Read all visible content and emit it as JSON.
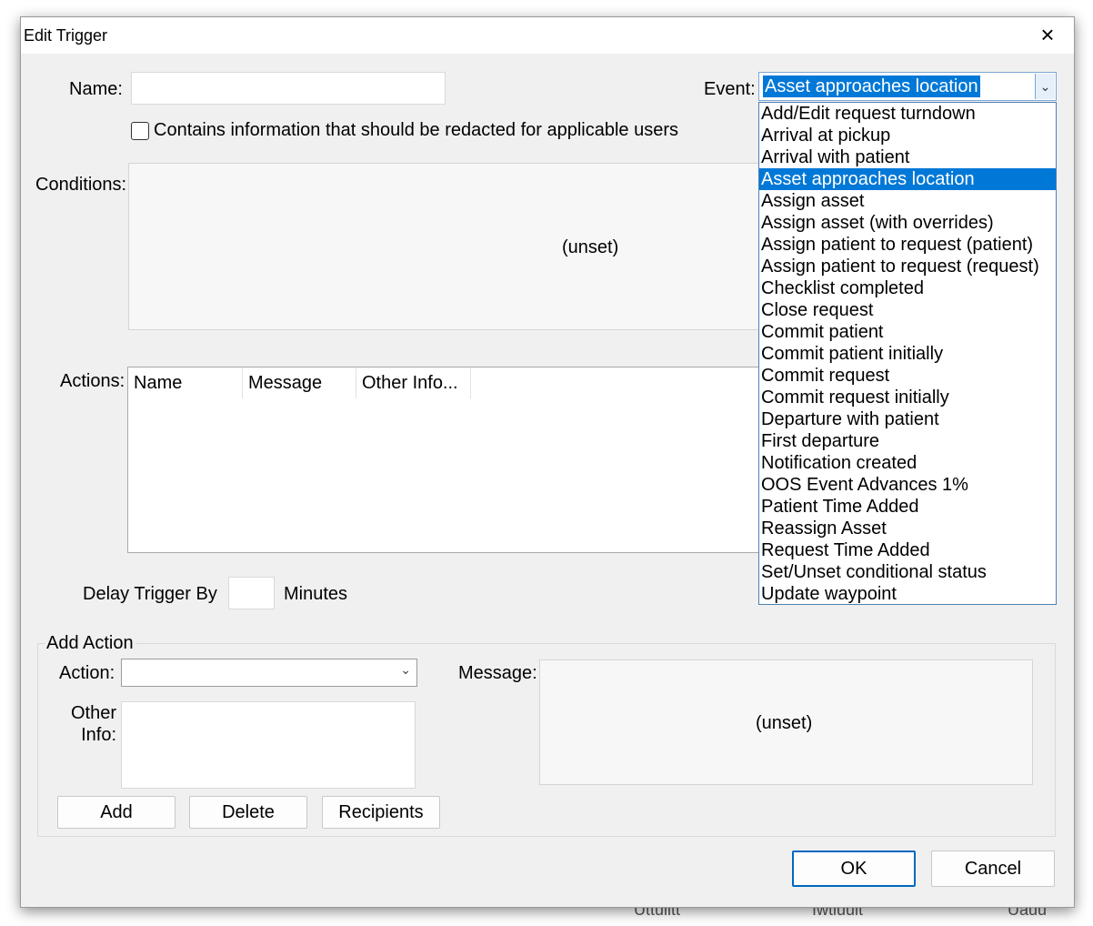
{
  "background": {
    "partial_labels": [
      "Uttuiitt",
      "Iwtiuuit",
      "Uauu"
    ]
  },
  "dialog": {
    "title": "Edit Trigger",
    "close_label": "×"
  },
  "name": {
    "label": "Name:",
    "value": ""
  },
  "redact": {
    "label": "Contains information that should be redacted for applicable users",
    "checked": false
  },
  "event": {
    "label": "Event:",
    "selected": "Asset approaches location",
    "options": [
      "Add/Edit request turndown",
      "Arrival at pickup",
      "Arrival with patient",
      "Asset approaches location",
      "Assign asset",
      "Assign asset (with overrides)",
      "Assign patient to request (patient)",
      "Assign patient to request (request)",
      "Checklist completed",
      "Close request",
      "Commit patient",
      "Commit patient initially",
      "Commit request",
      "Commit request initially",
      "Departure with patient",
      "First departure",
      "Notification created",
      "OOS Event Advances 1%",
      "Patient Time Added",
      "Reassign Asset",
      "Request Time Added",
      "Set/Unset conditional status",
      "Update waypoint"
    ]
  },
  "conditions": {
    "label": "Conditions:",
    "value": "(unset)"
  },
  "actions": {
    "label": "Actions:",
    "columns": [
      "Name",
      "Message",
      "Other Info..."
    ]
  },
  "delay": {
    "label": "Delay Trigger By",
    "value": "",
    "unit": "Minutes"
  },
  "add_action": {
    "group_label": "Add Action",
    "action_label": "Action:",
    "action_value": "",
    "message_label": "Message:",
    "message_value": "(unset)",
    "other_info_label_1": "Other",
    "other_info_label_2": "Info:",
    "add_button": "Add",
    "delete_button": "Delete",
    "recipients_button": "Recipients"
  },
  "footer": {
    "ok": "OK",
    "cancel": "Cancel"
  },
  "colors": {
    "selection": "#0078d7",
    "dialog_bg": "#f0f0f0",
    "ok_border": "#0067c0"
  }
}
